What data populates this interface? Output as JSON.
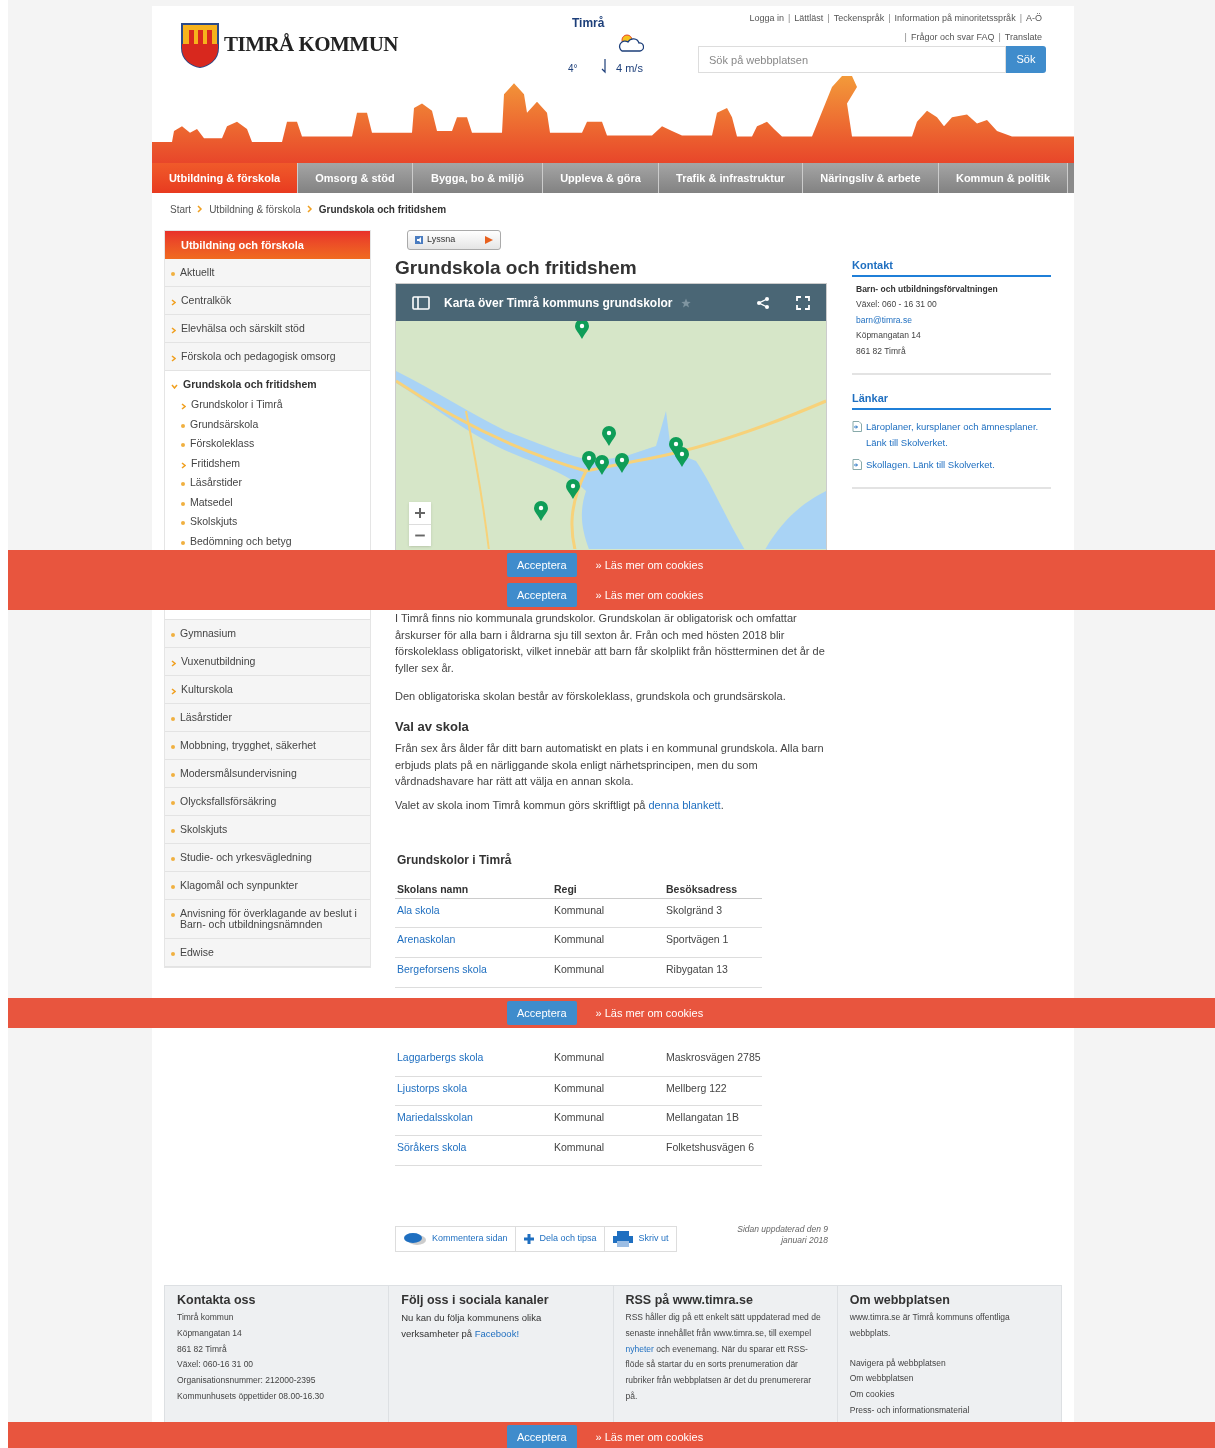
{
  "header": {
    "logo_text": "TIMRÅ KOMMUN",
    "weather": {
      "place": "Timrå",
      "temperature": "4°",
      "wind": "4 m/s"
    },
    "link_separator": "|",
    "top_links": [
      "Logga in",
      "Lättläst",
      "Teckenspråk",
      "Information på minoritetsspråk",
      "A-Ö"
    ],
    "top_links_2": [
      "Frågor och svar FAQ",
      "Translate"
    ],
    "search": {
      "placeholder": "Sök på webbplatsen",
      "button": "Sök"
    }
  },
  "nav": [
    {
      "label": "Utbildning & förskola",
      "selected": true
    },
    {
      "label": "Omsorg & stöd",
      "selected": false
    },
    {
      "label": "Bygga, bo & miljö",
      "selected": false
    },
    {
      "label": "Uppleva & göra",
      "selected": false
    },
    {
      "label": "Trafik & infrastruktur",
      "selected": false
    },
    {
      "label": "Näringsliv & arbete",
      "selected": false
    },
    {
      "label": "Kommun & politik",
      "selected": false
    }
  ],
  "breadcrumb": [
    "Start",
    "Utbildning & förskola",
    "Grundskola och fritidshem"
  ],
  "sidebar": {
    "title": "Utbildning och förskola",
    "items": [
      {
        "label": "Aktuellt",
        "kind": "page"
      },
      {
        "label": "Centralkök",
        "kind": "section"
      },
      {
        "label": "Elevhälsa och särskilt stöd",
        "kind": "section"
      },
      {
        "label": "Förskola och pedagogisk omsorg",
        "kind": "section"
      },
      {
        "label": "Grundskola och fritidshem",
        "kind": "open",
        "children": [
          {
            "label": "Grundskolor i Timrå",
            "kind": "section"
          },
          {
            "label": "Grundsärskola",
            "kind": "page"
          },
          {
            "label": "Förskoleklass",
            "kind": "page"
          },
          {
            "label": "Fritidshem",
            "kind": "section"
          },
          {
            "label": "Läsårstider",
            "kind": "page"
          },
          {
            "label": "Matsedel",
            "kind": "page"
          },
          {
            "label": "Skolskjuts",
            "kind": "page"
          },
          {
            "label": "Bedömning och betyg",
            "kind": "page"
          }
        ]
      },
      {
        "label": "Gymnasium",
        "kind": "page"
      },
      {
        "label": "Vuxenutbildning",
        "kind": "section"
      },
      {
        "label": "Kulturskola",
        "kind": "section"
      },
      {
        "label": "Läsårstider",
        "kind": "page"
      },
      {
        "label": "Mobbning, trygghet, säkerhet",
        "kind": "page"
      },
      {
        "label": "Modersmålsundervisning",
        "kind": "page"
      },
      {
        "label": "Olycksfallsförsäkring",
        "kind": "page"
      },
      {
        "label": "Skolskjuts",
        "kind": "page"
      },
      {
        "label": "Studie- och yrkesvägledning",
        "kind": "page"
      },
      {
        "label": "Klagomål och synpunkter",
        "kind": "page"
      },
      {
        "label": "Anvisning för överklagande av beslut i Barn- och utbildningsnämnden",
        "kind": "page"
      },
      {
        "label": "Edwise",
        "kind": "page"
      }
    ]
  },
  "main": {
    "listen_button": "Lyssna",
    "title": "Grundskola och fritidshem",
    "map": {
      "title": "Karta över Timrå kommuns grundskolor"
    },
    "intro": "I Timrå finns nio kommunala grundskolor. Grundskolan är obligatorisk och omfattar årskurser för alla barn i åldrarna sju till sexton år. Från och med hösten 2018 blir förskoleklass obligatoriskt, vilket innebär att barn får skolplikt från höstterminen det år de fyller sex år.",
    "paragraph_2": "Den obligatoriska skolan består av förskoleklass, grundskola och grundsärskola.",
    "subheading": "Val av skola",
    "paragraph_3": "Från sex års ålder får ditt barn automatiskt en plats i en kommunal grundskola. Alla barn erbjuds plats på en närliggande skola enligt närhetsprincipen, men du som vårdnadshavare har rätt att välja en annan skola.",
    "paragraph_4": {
      "text": "Valet av skola inom Timrå kommun görs skriftligt på ",
      "link": "denna blankett",
      "end": "."
    },
    "table": {
      "title": "Grundskolor i Timrå",
      "columns": [
        "Skolans namn",
        "Regi",
        "Besöksadress"
      ],
      "rows": [
        [
          "Ala skola",
          "Kommunal",
          "Skolgränd 3"
        ],
        [
          "Arenaskolan",
          "Kommunal",
          "Sportvägen 1"
        ],
        [
          "Bergeforsens skola",
          "Kommunal",
          "Ribygatan 13"
        ],
        [
          "Laggarbergs skola",
          "Kommunal",
          "Maskrosvägen 2785"
        ],
        [
          "Ljustorps skola",
          "Kommunal",
          "Mellberg 122"
        ],
        [
          "Mariedalsskolan",
          "Kommunal",
          "Mellangatan 1B"
        ],
        [
          "Söråkers skola",
          "Kommunal",
          "Folketshusvägen 6"
        ]
      ]
    },
    "tools": [
      "Kommentera sidan",
      "Dela och tipsa",
      "Skriv ut"
    ],
    "updated": "Sidan uppdaterad den 9 januari 2018"
  },
  "aside": {
    "contact": {
      "title": "Kontakt",
      "org": "Barn- och utbildningsförvaltningen",
      "phone": "Växel: 060 - 16 31 00",
      "email": "barn@timra.se",
      "street": "Köpmangatan 14",
      "city": "861 82 Timrå"
    },
    "links": {
      "title": "Länkar",
      "items": [
        "Läroplaner, kursplaner och ämnesplaner. Länk till Skolverket.",
        "Skollagen. Länk till Skolverket."
      ]
    }
  },
  "footer": [
    {
      "title": "Kontakta oss",
      "org_link": "Timrå kommun",
      "lines": [
        "Köpmangatan 14",
        "861 82 Timrå",
        "Växel: 060-16 31 00",
        "Organisationsnummer: 212000-2395",
        "Kommunhusets öppettider 08.00-16.30"
      ]
    },
    {
      "title": "Följ oss i sociala kanaler",
      "text": "Nu kan du följa kommunens olika verksamheter på ",
      "link": "Facebook!"
    },
    {
      "title": "RSS på www.timra.se",
      "text_a": "RSS håller dig på ett enkelt sätt uppdaterad med de senaste innehållet från www.timra.se, till exempel ",
      "link": "nyheter",
      "text_b": " och evenemang. När du sparar ett RSS-flöde så startar du en sorts prenumeration där rubriker från webbplatsen är det du prenumererar på."
    },
    {
      "title": "Om webbplatsen",
      "text": "www.timra.se är Timrå kommuns offentliga webbplats.",
      "links": [
        "Navigera på webbplatsen",
        "Om webbplatsen",
        "Om cookies",
        "Press- och informationsmaterial"
      ]
    }
  ],
  "cookie_banners": [
    {
      "button": "Acceptera",
      "link": "» Läs mer om cookies"
    },
    {
      "button": "Acceptera",
      "link": "» Läs mer om cookies"
    },
    {
      "button": "Acceptera",
      "link": "» Läs mer om cookies"
    },
    {
      "button": "Acceptera",
      "link": "» Läs mer om cookies"
    }
  ]
}
